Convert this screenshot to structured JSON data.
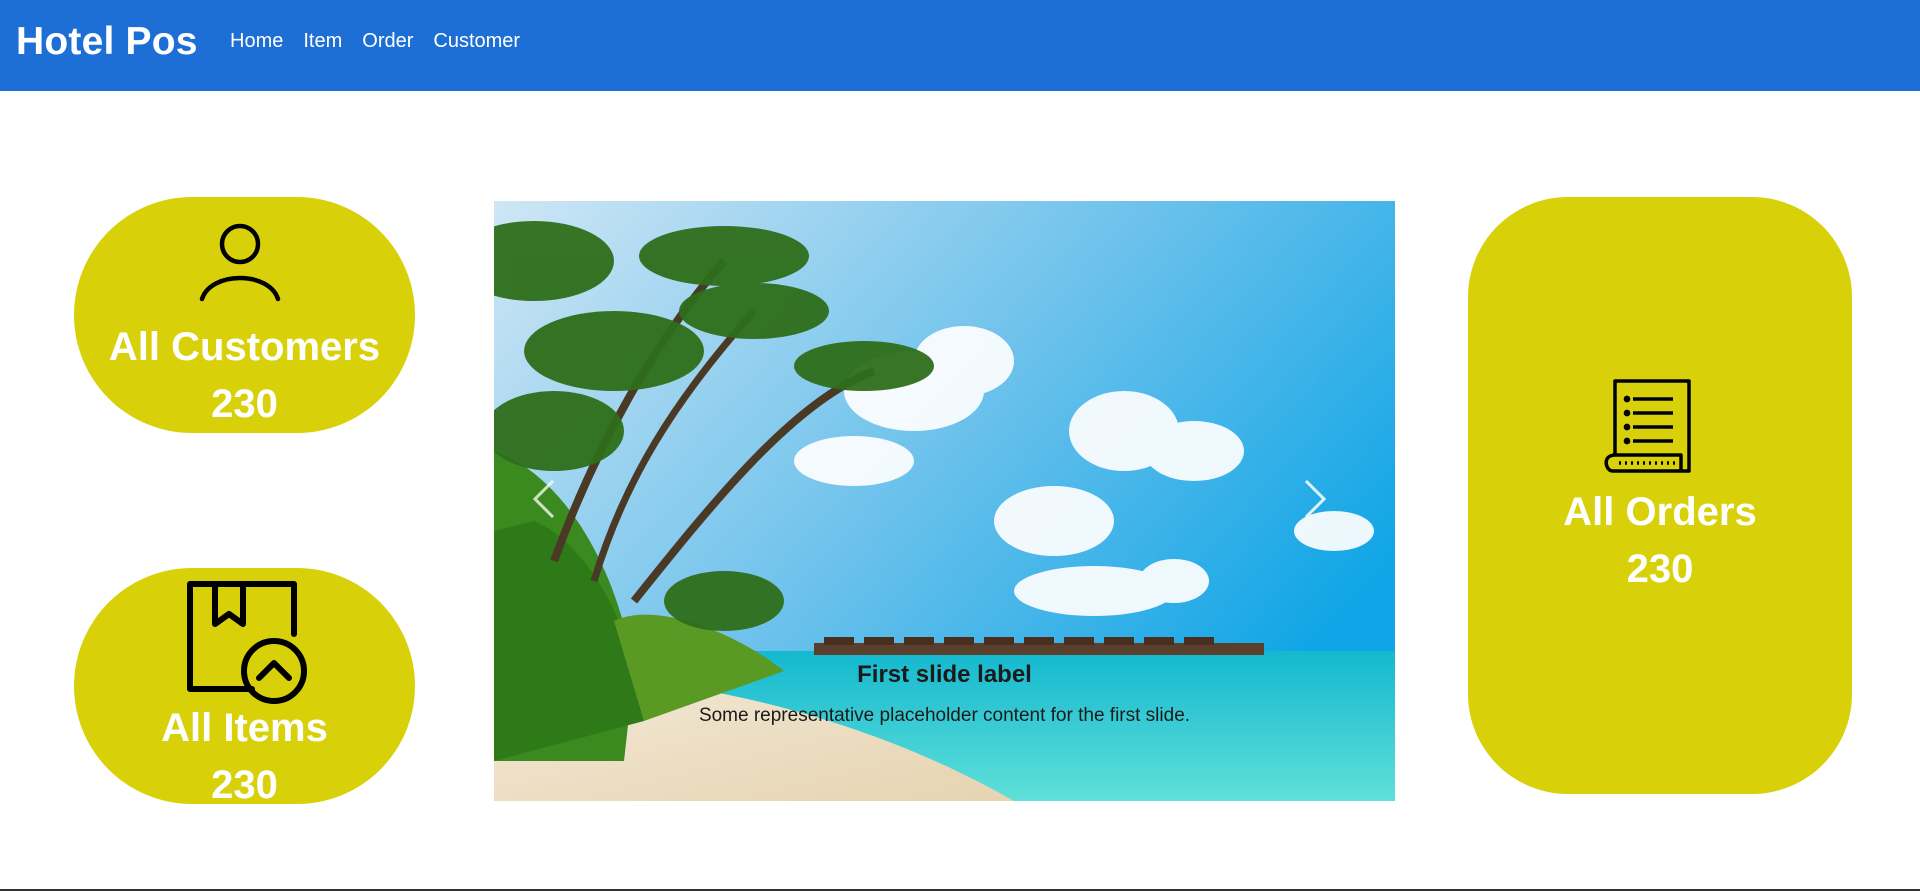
{
  "navbar": {
    "brand": "Hotel Pos",
    "links": [
      {
        "label": "Home"
      },
      {
        "label": "Item"
      },
      {
        "label": "Order"
      },
      {
        "label": "Customer"
      }
    ],
    "background": "#1d6ed5"
  },
  "cards": {
    "accent": "#d8d10a",
    "customers": {
      "title": "All Customers",
      "count": "230",
      "icon": "person-icon"
    },
    "items": {
      "title": "All Items",
      "count": "230",
      "icon": "package-icon"
    },
    "orders": {
      "title": "All Orders",
      "count": "230",
      "icon": "receipt-icon"
    }
  },
  "carousel": {
    "slide": {
      "title": "First slide label",
      "text": "Some representative placeholder content for the first slide."
    },
    "controls": {
      "prev_icon": "chevron-left-icon",
      "next_icon": "chevron-right-icon"
    }
  }
}
